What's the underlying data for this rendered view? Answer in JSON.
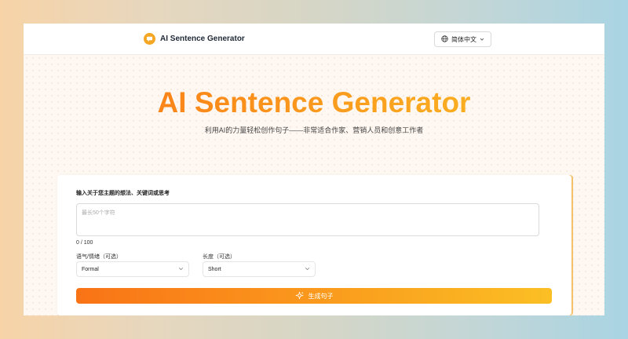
{
  "header": {
    "brand_name": "AI Sentence Generator",
    "brand_icon": "chat-bubble-icon",
    "language_label": "简体中文",
    "language_icon": "globe-icon"
  },
  "hero": {
    "title": "AI Sentence Generator",
    "subtitle": "利用AI的力量轻松创作句子——非常适合作家、营销人员和创意工作者"
  },
  "form": {
    "prompt_label": "输入关于您主题的想法、关键词或思考",
    "prompt_value": "",
    "prompt_placeholder": "最长50个字符",
    "char_counter": "0 / 100",
    "tone": {
      "label": "语气/情绪（可选）",
      "selected": "Formal"
    },
    "length": {
      "label": "长度（可选）",
      "selected": "Short"
    },
    "generate_label": "生成句子",
    "generate_icon": "sparkle-icon"
  },
  "colors": {
    "accent_start": "#f97316",
    "accent_end": "#fbbf24",
    "brand_icon_bg": "#f5a623"
  }
}
